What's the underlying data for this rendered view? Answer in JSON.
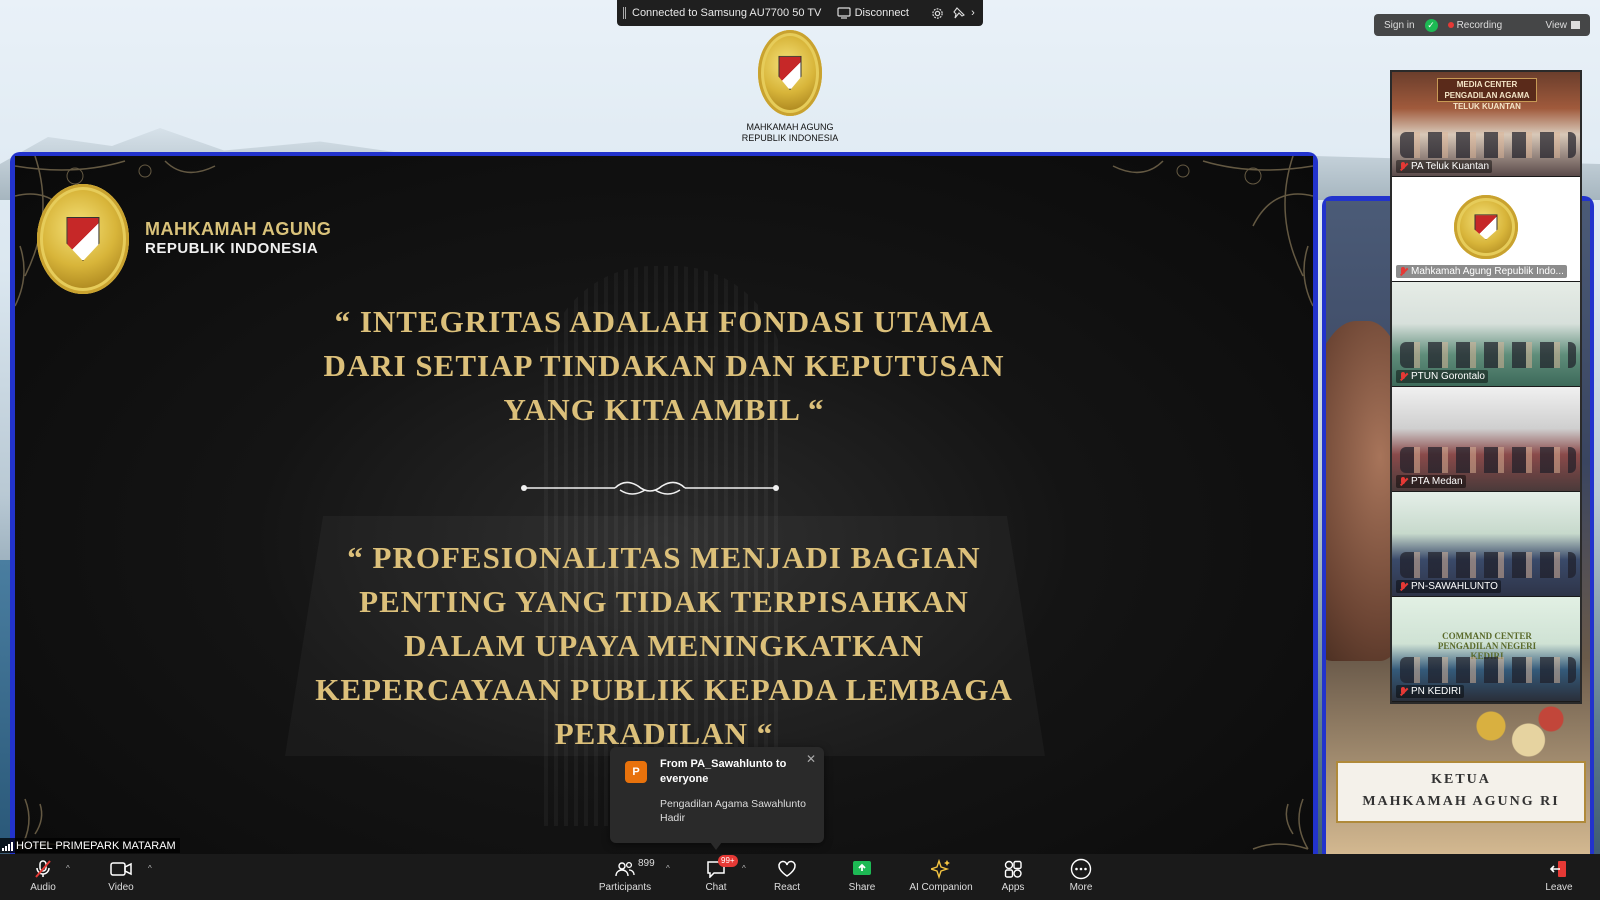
{
  "share_bar": {
    "status": "Connected to Samsung AU7700 50 TV",
    "disconnect_label": "Disconnect"
  },
  "top_emblem": {
    "caption_line1": "MAHKAMAH AGUNG",
    "caption_line2": "REPUBLIK INDONESIA"
  },
  "top_right": {
    "signin": "Sign in",
    "recording": "Recording",
    "view": "View"
  },
  "slide": {
    "logo_line1": "MAHKAMAH AGUNG",
    "logo_line2": "REPUBLIK INDONESIA",
    "quote1": [
      "“ INTEGRITAS ADALAH FONDASI UTAMA",
      "DARI SETIAP TINDAKAN DAN KEPUTUSAN",
      "YANG KITA AMBIL “"
    ],
    "quote2": [
      "“ PROFESIONALITAS MENJADI BAGIAN",
      "PENTING YANG TIDAK TERPISAHKAN",
      "DALAM UPAYA MENINGKATKAN",
      "KEPERCAYAAN PUBLIK KEPADA LEMBAGA",
      "PERADILAN “"
    ]
  },
  "speaker": {
    "plaque_line1": "KETUA",
    "plaque_line2": "MAHKAMAH AGUNG RI"
  },
  "gallery": {
    "tiles": [
      {
        "name": "PA Teluk Kuantan",
        "sign": "MEDIA CENTER PENGADILAN AGAMA TELUK KUANTAN",
        "muted": true
      },
      {
        "name": "Mahkamah Agung Republik Indo...",
        "muted": true
      },
      {
        "name": "PTUN Gorontalo",
        "muted": true
      },
      {
        "name": "PTA Medan",
        "muted": true
      },
      {
        "name": "PN-SAWAHLUNTO",
        "muted": true
      },
      {
        "name": "PN KEDIRI",
        "sign": "COMMAND CENTER PENGADILAN NEGERI KEDIRI",
        "muted": true
      }
    ]
  },
  "toast": {
    "avatar_letter": "P",
    "from": "From PA_Sawahlunto to everyone",
    "message": "Pengadilan Agama Sawahlunto Hadir"
  },
  "self_label": "HOTEL PRIMEPARK MATARAM",
  "toolbar": {
    "audio": "Audio",
    "video": "Video",
    "participants": "Participants",
    "participant_count": "899",
    "chat": "Chat",
    "chat_badge": "99+",
    "react": "React",
    "share": "Share",
    "ai_companion": "AI Companion",
    "apps": "Apps",
    "more": "More",
    "leave": "Leave"
  },
  "colors": {
    "active_border": "#2233cc",
    "slide_gold": "#dcc07a",
    "toolbar_bg": "#1a1a1a",
    "share_green": "#1db954",
    "record_red": "#e53935"
  }
}
